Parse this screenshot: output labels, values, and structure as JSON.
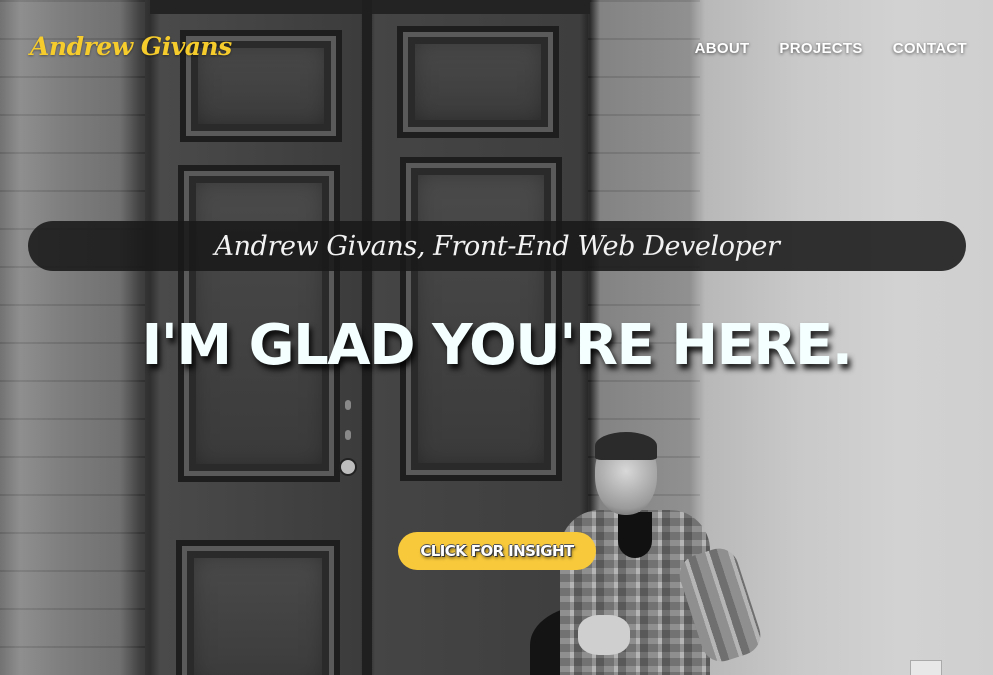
{
  "nav": {
    "logo": "Andrew Givans",
    "links": [
      "ABOUT",
      "PROJECTS",
      "CONTACT"
    ]
  },
  "hero": {
    "subtitle": "Andrew Givans, Front-End Web Developer",
    "headline": "I'M GLAD YOU'RE HERE.",
    "cta_label": "CLICK FOR INSIGHT"
  },
  "colors": {
    "accent": "#f6cc2d",
    "subtitle_bar": "#191919",
    "headline_text": "#f4ffff"
  }
}
